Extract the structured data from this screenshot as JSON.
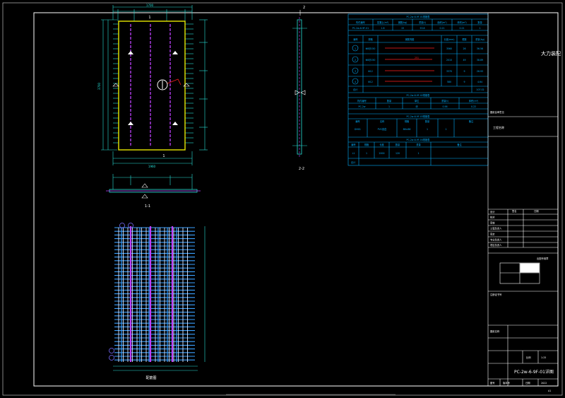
{
  "colors": {
    "bg": "#000000",
    "frame": "#ffffff",
    "dim": "#27e0d8",
    "rebar": "#3aa0ff",
    "embed": "#c040ff",
    "panel_edge": "#e6e600",
    "red": "#ff2020",
    "table": "#00b0ff"
  },
  "drawing": {
    "section_1_1": "1-1",
    "section_2_2": "2-2",
    "rebar_plan": "配筋图",
    "top_mark": "1",
    "bottom_mark": "1",
    "side_mark_top": "2",
    "side_mark_bottom": "2",
    "width_dim": "1700",
    "total_width_dim": "1960",
    "height_dim": "3700"
  },
  "tables": {
    "t1_title": "PC-2w-6-9F-01规格表",
    "t1_headers": [
      "构件编号",
      "混凝土(m³)",
      "钢筋(kg)",
      "重量(t)",
      "面积(m²)",
      "体积(m³)",
      "数量"
    ],
    "t1_row": [
      "PC-2w-6-9F-01",
      "1.6",
      "15",
      "53.8",
      "0.21",
      "0.21",
      "1"
    ],
    "t2_title": "钢筋明细表",
    "t2_headers": [
      "编号",
      "规格",
      "钢筋简图",
      "长度(mm)",
      "根数",
      "重量(kg)"
    ],
    "t2_rows": [
      [
        "1",
        "Φ8@150",
        "",
        "3560",
        "26",
        "36.56"
      ],
      [
        "2",
        "Φ8@150",
        "251",
        "2010",
        "49",
        "38.89"
      ],
      [
        "3",
        "Φ12",
        "",
        "3370",
        "9",
        "26.93"
      ],
      [
        "4",
        "Φ12",
        "",
        "580",
        "9",
        "4.64"
      ]
    ],
    "t2_total_label": "合计",
    "t2_total_value": "107.02",
    "t3_title": "PC-2w-6-9F-02规格表",
    "t3_headers": [
      "构件编号",
      "数量",
      "单位",
      "重量(t)",
      "体积(m³)"
    ],
    "t3_row": [
      "PC-2w",
      "1",
      "块",
      "0.56",
      "0.22"
    ],
    "t4_title": "PC-2w-6-9F-03规格表",
    "t4_headers": [
      "编号",
      "名称",
      "规格",
      "数量",
      "备注"
    ],
    "t4_row": [
      "DH01",
      "PVC线盒",
      "86×86",
      "1",
      "1"
    ],
    "t5_title": "PC-2w-6-9F-04规格表",
    "t5_headers": [
      "编号",
      "规格",
      "长度",
      "数量",
      "重量",
      "备注"
    ],
    "t5_row": [
      "L1",
      "1",
      "2000",
      "120",
      "1",
      ""
    ],
    "t5_total": "合计"
  },
  "title_block": {
    "company": "大力装配",
    "note": "图纸会审意见",
    "project_label": "工程名称",
    "roles": [
      "设计",
      "校对",
      "审核",
      "工程负责人",
      "审定",
      "专业负责人",
      "项目负责人"
    ],
    "cols": [
      "签名",
      "日期"
    ],
    "stamp_label": "出图专用章",
    "certificate": "注册证书号",
    "drawing_label": "图纸名称",
    "scale_label": "比例",
    "scale": "1:25",
    "drawing_name": "PC-2w-6-9F-01详图",
    "no_label": "图号",
    "version_label": "版本号",
    "date_label": "日期",
    "date": "2022",
    "sheet": "A1"
  }
}
